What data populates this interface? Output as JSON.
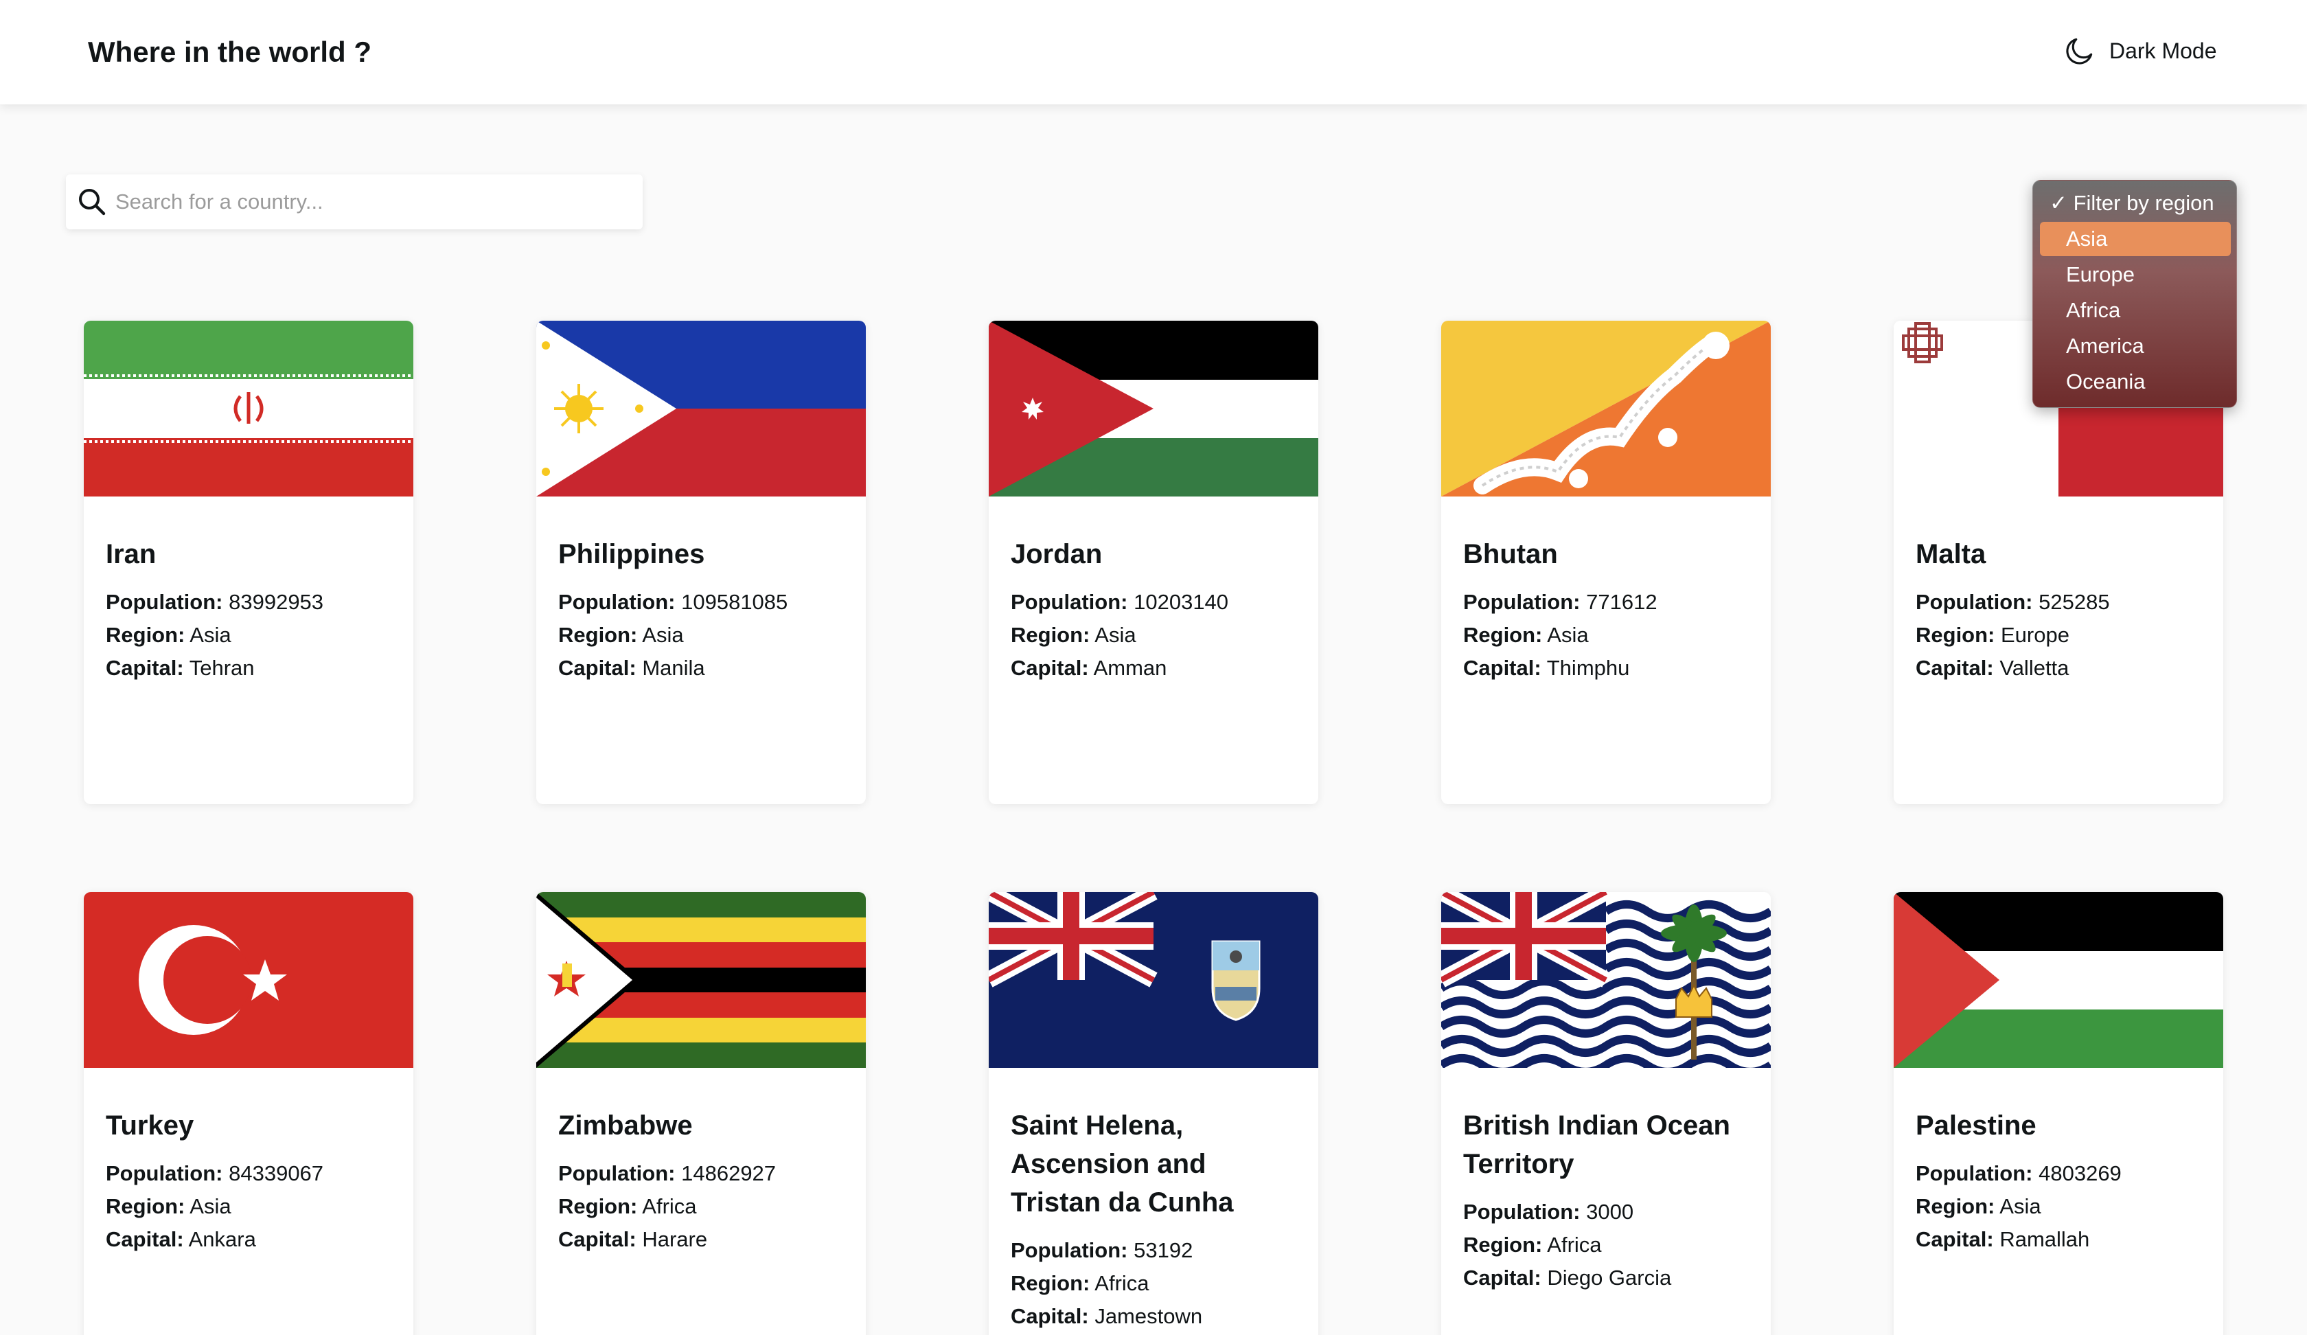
{
  "header": {
    "title": "Where in the world ?",
    "mode_label": "Dark Mode",
    "mode_icon": "moon-icon"
  },
  "search": {
    "placeholder": "Search for a country...",
    "value": "",
    "icon": "search-icon"
  },
  "filter": {
    "options": [
      "Filter by region",
      "Asia",
      "Europe",
      "Africa",
      "America",
      "Oceania"
    ],
    "checked": "Filter by region",
    "highlighted": "Asia",
    "highlight_color": "#e8905b"
  },
  "field_labels": {
    "population": "Population:",
    "region": "Region:",
    "capital": "Capital:"
  },
  "countries": [
    {
      "name": "Iran",
      "population": "83992953",
      "region": "Asia",
      "capital": "Tehran"
    },
    {
      "name": "Philippines",
      "population": "109581085",
      "region": "Asia",
      "capital": "Manila"
    },
    {
      "name": "Jordan",
      "population": "10203140",
      "region": "Asia",
      "capital": "Amman"
    },
    {
      "name": "Bhutan",
      "population": "771612",
      "region": "Asia",
      "capital": "Thimphu"
    },
    {
      "name": "Malta",
      "population": "525285",
      "region": "Europe",
      "capital": "Valletta"
    },
    {
      "name": "Turkey",
      "population": "84339067",
      "region": "Asia",
      "capital": "Ankara"
    },
    {
      "name": "Zimbabwe",
      "population": "14862927",
      "region": "Africa",
      "capital": "Harare"
    },
    {
      "name": "Saint Helena, Ascension and Tristan da Cunha",
      "population": "53192",
      "region": "Africa",
      "capital": "Jamestown"
    },
    {
      "name": "British Indian Ocean Territory",
      "population": "3000",
      "region": "Africa",
      "capital": "Diego Garcia"
    },
    {
      "name": "Palestine",
      "population": "4803269",
      "region": "Asia",
      "capital": "Ramallah"
    }
  ]
}
